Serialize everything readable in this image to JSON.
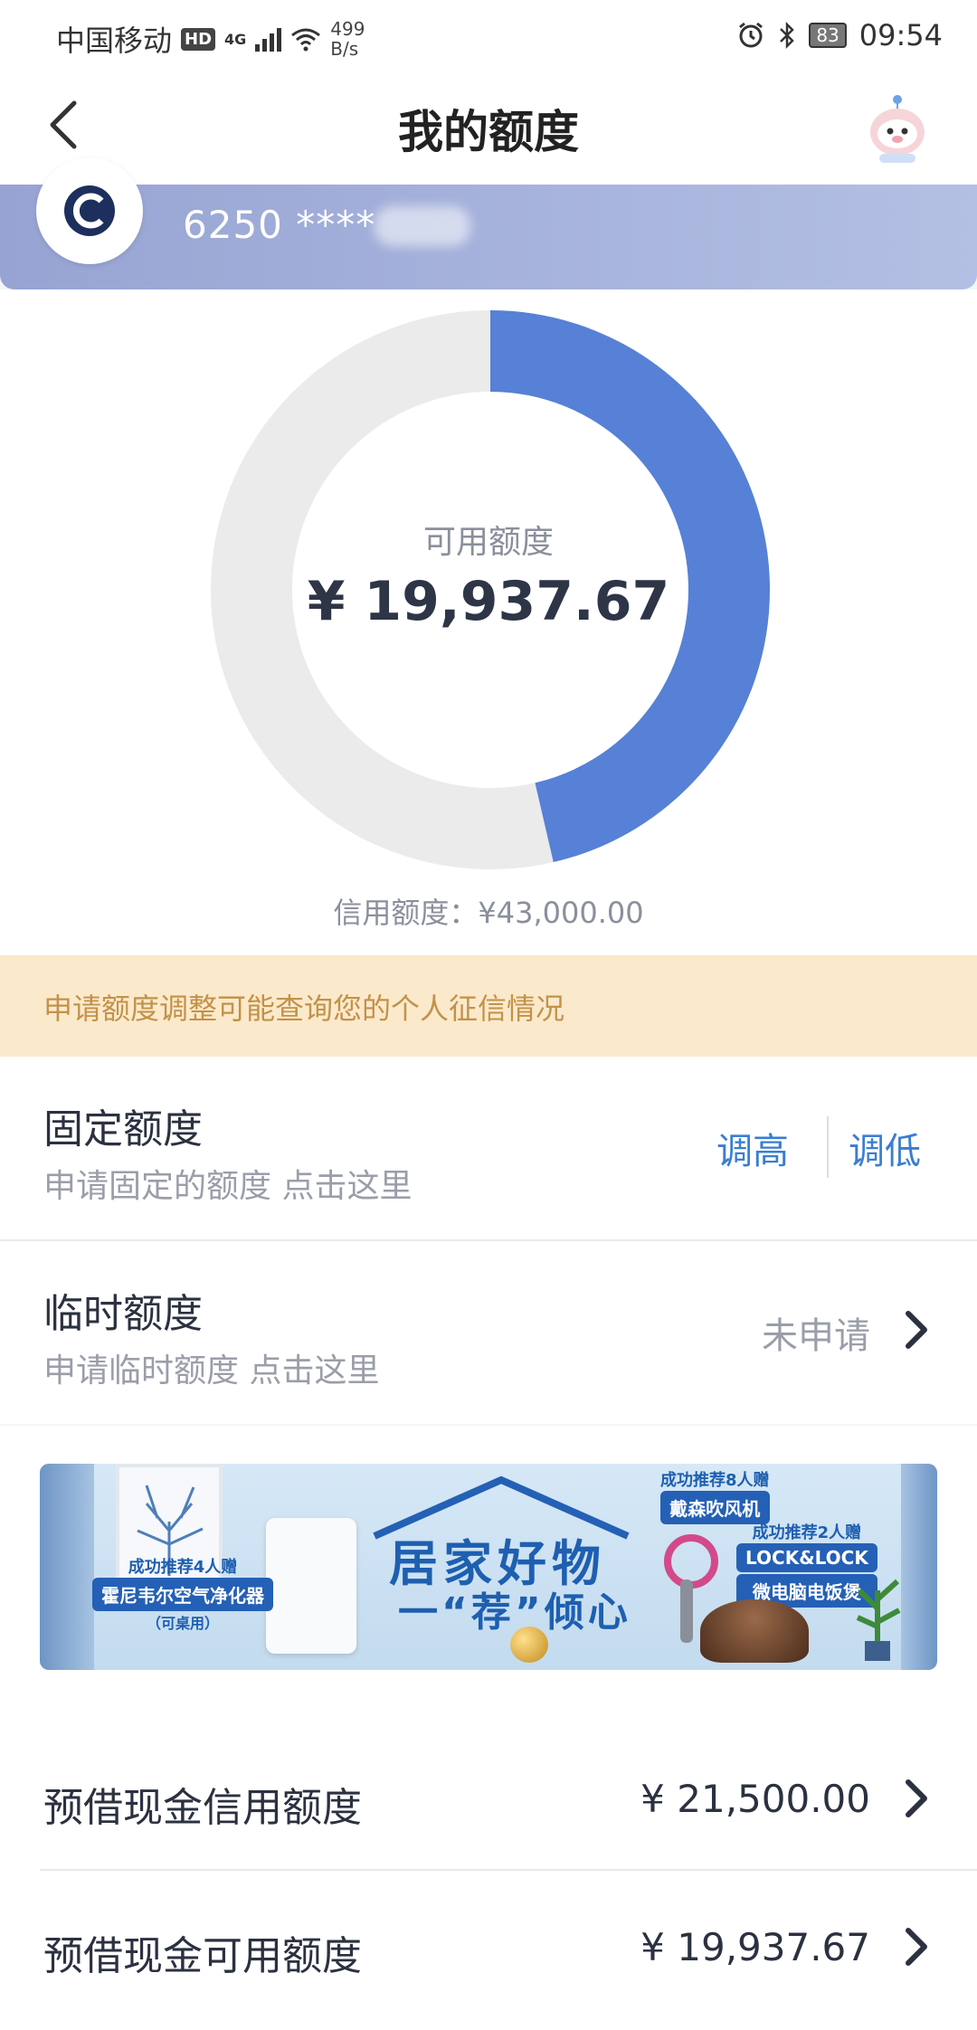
{
  "status_bar": {
    "carrier": "中国移动",
    "hd_badge": "HD",
    "network": "4G",
    "speed_value": "499",
    "speed_unit": "B/s",
    "battery": "83",
    "time": "09:54"
  },
  "header": {
    "title": "我的额度"
  },
  "card": {
    "number_masked": "6250 ****"
  },
  "quota": {
    "available_label": "可用额度",
    "available_value": "¥ 19,937.67",
    "credit_limit_text": "信用额度：¥43,000.00",
    "available_fraction": 0.4637,
    "colors": {
      "used_track": "#ebebeb",
      "available_arc": "#5681d6"
    }
  },
  "notice": {
    "text": "申请额度调整可能查询您的个人征信情况"
  },
  "fixed_quota": {
    "title": "固定额度",
    "subtitle": "申请固定的额度 点击这里",
    "increase_label": "调高",
    "decrease_label": "调低"
  },
  "temp_quota": {
    "title": "临时额度",
    "subtitle": "申请临时额度 点击这里",
    "status": "未申请"
  },
  "banner": {
    "headline": "居家好物",
    "subline": "一“荐”倾心",
    "left_tag_top": "成功推荐4人赠",
    "left_tag": "霍尼韦尔空气净化器",
    "left_tag_note": "（可桌用）",
    "right_tag1_top": "成功推荐8人赠",
    "right_tag1": "戴森吹风机",
    "right_tag2_top": "成功推荐2人赠",
    "right_tag2_brand": "LOCK&LOCK",
    "right_tag2": "微电脑电饭煲"
  },
  "cash": {
    "credit_label": "预借现金信用额度",
    "credit_value": "¥ 21,500.00",
    "available_label": "预借现金可用额度",
    "available_value": "¥ 19,937.67"
  }
}
